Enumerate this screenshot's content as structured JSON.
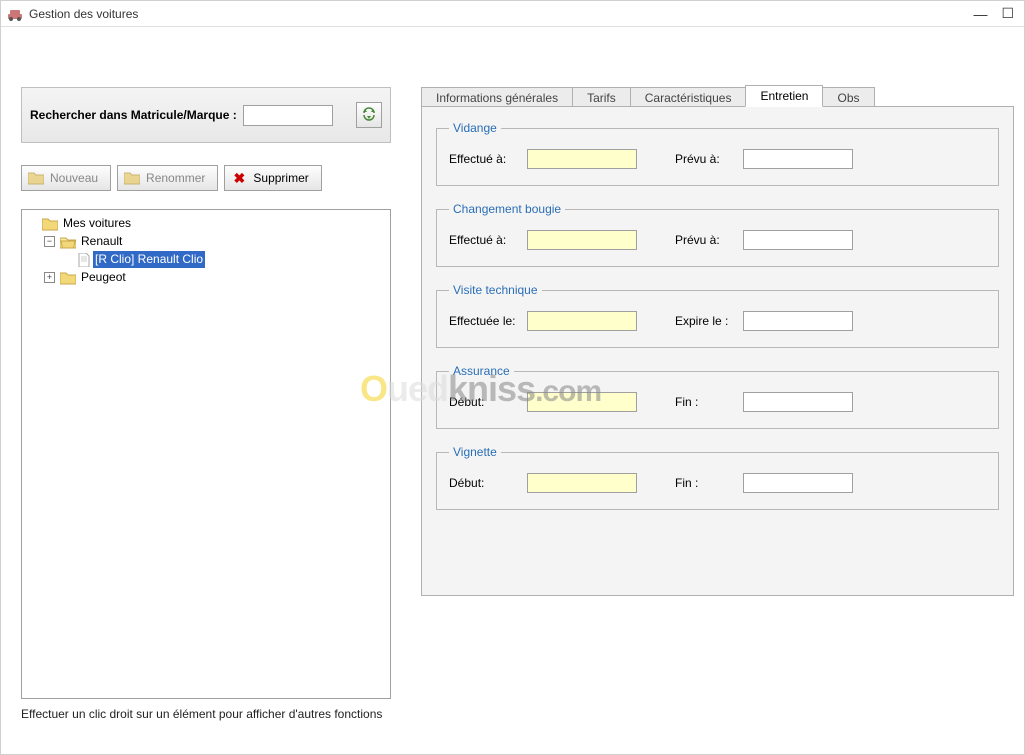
{
  "window": {
    "title": "Gestion des voitures"
  },
  "search": {
    "label": "Rechercher dans Matricule/Marque :",
    "value": "",
    "placeholder": ""
  },
  "toolbar": {
    "new_label": "Nouveau",
    "rename_label": "Renommer",
    "delete_label": "Supprimer"
  },
  "tree": {
    "root": "Mes voitures",
    "children": [
      {
        "label": "Renault",
        "expanded": true,
        "children": [
          {
            "label": "[R Clio] Renault Clio",
            "selected": true,
            "leaf": true
          }
        ]
      },
      {
        "label": "Peugeot",
        "expanded": false
      }
    ]
  },
  "footer_hint": "Effectuer un clic droit sur un élément pour afficher d'autres fonctions",
  "tabs": {
    "items": [
      {
        "label": "Informations générales",
        "active": false
      },
      {
        "label": "Tarifs",
        "active": false
      },
      {
        "label": "Caractéristiques",
        "active": false
      },
      {
        "label": "Entretien",
        "active": true
      },
      {
        "label": "Obs",
        "active": false
      }
    ]
  },
  "entretien": {
    "groups": [
      {
        "legend": "Vidange",
        "left_label": "Effectué à:",
        "left_value": "",
        "right_label": "Prévu à:",
        "right_value": ""
      },
      {
        "legend": "Changement bougie",
        "left_label": "Effectué à:",
        "left_value": "",
        "right_label": "Prévu à:",
        "right_value": ""
      },
      {
        "legend": "Visite technique",
        "left_label": "Effectuée le:",
        "left_value": "",
        "right_label": "Expire le :",
        "right_value": ""
      },
      {
        "legend": "Assurance",
        "left_label": "Début:",
        "left_value": "",
        "right_label": "Fin :",
        "right_value": ""
      },
      {
        "legend": "Vignette",
        "left_label": "Début:",
        "left_value": "",
        "right_label": "Fin :",
        "right_value": ""
      }
    ]
  },
  "watermark": {
    "text_o": "O",
    "text_ued": "ued",
    "text_kniss": "kniss",
    "text_com": ".com"
  }
}
